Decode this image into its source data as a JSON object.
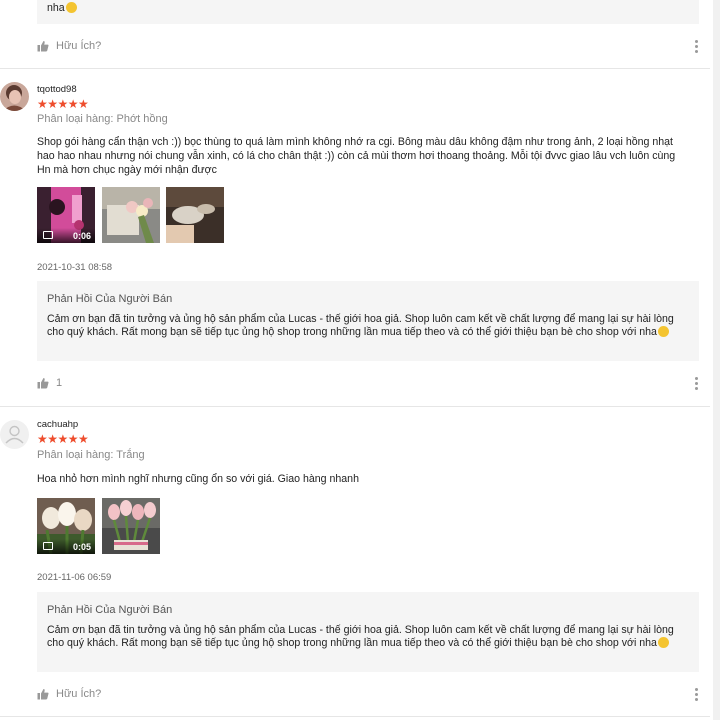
{
  "top_reply": {
    "tail": "nha"
  },
  "helpful_label": "Hữu Ích?",
  "reviews": [
    {
      "username": "tqottod98",
      "stars": "★★★★★",
      "variant": "Phân loại hàng: Phớt hồng",
      "comment": "Shop gói hàng cẩn thận vch :)) bọc thùng to quá làm mình không nhớ ra cgi. Bông màu dâu không đậm như trong ảnh, 2 loại hồng nhạt hao hao nhau nhưng nói chung vẫn xinh, có lá cho chân thật :)) còn cả mùi thơm hơi thoang thoảng. Mỗi tội đvvc giao lâu vch luôn cùng Hn mà hơn chục ngày mới nhận được",
      "video_duration": "0:06",
      "timestamp": "2021-10-31 08:58",
      "reply_title": "Phản Hồi Của Người Bán",
      "reply_text": "Cảm ơn bạn đã tin tưởng và ủng hộ sản phẩm của Lucas - thế giới hoa giả. Shop luôn cam kết về chất lượng để mang lại sự hài lòng cho quý khách. Rất mong bạn sẽ tiếp tục ủng hộ shop trong những lần mua tiếp theo và có thể giới thiệu bạn bè cho shop với nha",
      "likes": "1"
    },
    {
      "username": "cachuahp",
      "stars": "★★★★★",
      "variant": "Phân loại hàng: Trắng",
      "comment": "Hoa nhỏ hơn mình nghĩ nhưng cũng ổn so với giá. Giao hàng nhanh",
      "video_duration": "0:05",
      "timestamp": "2021-11-06 06:59",
      "reply_title": "Phản Hồi Của Người Bán",
      "reply_text": "Cảm ơn bạn đã tin tưởng và ủng hộ sản phẩm của Lucas - thế giới hoa giả. Shop luôn cam kết về chất lượng để mang lại sự hài lòng cho quý khách. Rất mong bạn sẽ tiếp tục ủng hộ shop trong những lần mua tiếp theo và có thể giới thiệu bạn bè cho shop với nha"
    }
  ],
  "colors": {
    "star": "#ee4d2d",
    "reply_bg": "#f5f5f5",
    "muted": "#888888"
  }
}
